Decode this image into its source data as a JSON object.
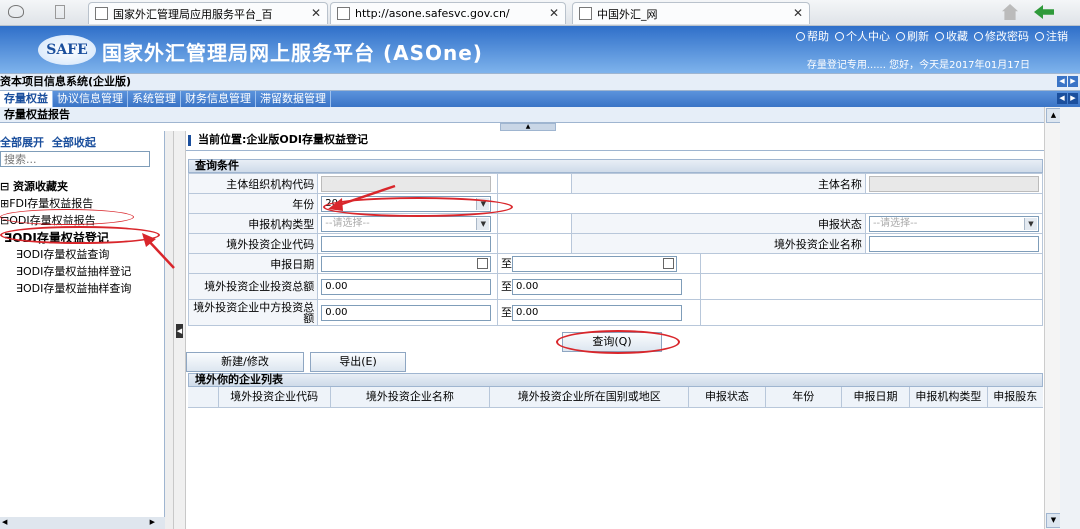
{
  "browser": {
    "tabs": [
      {
        "label": "国家外汇管理局应用服务平台_百"
      },
      {
        "label": "http://asone.safesvc.gov.cn/"
      },
      {
        "label": "中国外汇_网"
      }
    ]
  },
  "header": {
    "logo": "SAFE",
    "title": "国家外汇管理局网上服务平台 (ASOne)",
    "links": [
      "帮助",
      "个人中心",
      "刷新",
      "收藏",
      "修改密码",
      "注销"
    ],
    "welcome": "存量登记专用...... 您好，今天是2017年01月17日"
  },
  "system": {
    "title": "资本项目信息系统(企业版)"
  },
  "menu": {
    "items": [
      "存量权益",
      "协议信息管理",
      "系统管理",
      "财务信息管理",
      "滞留数据管理"
    ]
  },
  "submenu": {
    "label": "存量权益报告"
  },
  "sidebar": {
    "expand_all": "全部展开",
    "collapse_all": "全部收起",
    "search_placeholder": "搜索...",
    "favorites": "资源收藏夹",
    "groups": [
      {
        "label": "FDI存量权益报告"
      },
      {
        "label": "ODI存量权益报告"
      }
    ],
    "items": [
      "ODI存量权益登记",
      "ODI存量权益查询",
      "ODI存量权益抽样登记",
      "ODI存量权益抽样查询"
    ]
  },
  "main": {
    "breadcrumb": "当前位置:企业版ODI存量权益登记",
    "query_title": "查询条件",
    "fields": {
      "org_code_label": "主体组织机构代码",
      "name_label": "主体名称",
      "year_label": "年份",
      "year_value": "20",
      "type_label": "申报机构类型",
      "type_placeholder": "--请选择--",
      "status_label": "申报状态",
      "status_placeholder": "--请选择--",
      "invest_code_label": "境外投资企业代码",
      "invest_name_label": "境外投资企业名称",
      "date_label": "申报日期",
      "date_to": "至",
      "total_label": "境外投资企业投资总额",
      "total_from": "0.00",
      "total_to": "0.00",
      "china_label": "境外投资企业中方投资总额",
      "china_from": "0.00",
      "china_to": "0.00"
    },
    "search_button": "查询(Q)",
    "new_button": "新建/修改",
    "export_button": "导出(E)",
    "list_title": "境外你的企业列表",
    "columns": [
      "",
      "境外投资企业代码",
      "境外投资企业名称",
      "境外投资企业所在国别或地区",
      "申报状态",
      "年份",
      "申报日期",
      "申报机构类型",
      "申报股东"
    ]
  }
}
